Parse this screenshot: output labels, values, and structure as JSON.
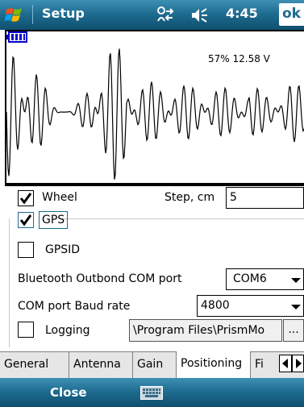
{
  "titlebar": {
    "title": "Setup",
    "time": "4:45",
    "ok_label": "ok",
    "icons": {
      "start": "windows-flag-icon",
      "network": "network-sync-icon",
      "volume": "volume-muted-icon"
    }
  },
  "plot": {
    "battery_text": "57% 12.58 V",
    "battery_icon": "battery-icon",
    "trace_color": "#000000"
  },
  "wheel": {
    "label": "Wheel",
    "checked": true,
    "step_label": "Step, cm",
    "step_value": "5"
  },
  "gps": {
    "label": "GPS",
    "checked": true
  },
  "gpsid": {
    "label": "GPSID",
    "checked": false
  },
  "bluetooth": {
    "label": "Bluetooth Outbond COM port",
    "value": "COM6"
  },
  "baud": {
    "label": "COM port Baud rate",
    "value": "4800"
  },
  "logging": {
    "label": "Logging",
    "checked": false,
    "path": "\\Program Files\\PrismMo",
    "browse_label": "..."
  },
  "tabs": [
    {
      "label": "General"
    },
    {
      "label": "Antenna"
    },
    {
      "label": "Gain"
    },
    {
      "label": "Positioning",
      "active": true
    },
    {
      "label": "Fi"
    }
  ],
  "bottombar": {
    "close_label": "Close",
    "keyboard_icon": "keyboard-icon"
  },
  "colors": {
    "bar": "#1c6a8e",
    "accent_check_border": "#1c6a8e"
  }
}
